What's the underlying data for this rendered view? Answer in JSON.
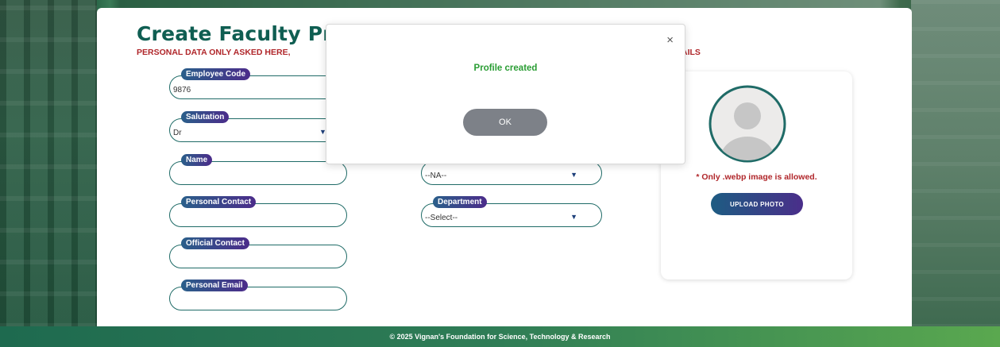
{
  "page": {
    "title": "Create Faculty Pro",
    "subtitle": "PERSONAL DATA ONLY ASKED HERE,",
    "subtitle_tail": "AILS"
  },
  "fields": {
    "employee_code": {
      "label": "Employee Code",
      "value": "9876"
    },
    "salutation": {
      "label": "Salutation",
      "value": "Dr"
    },
    "name": {
      "label": "Name",
      "value": ""
    },
    "personal_contact": {
      "label": "Personal Contact",
      "value": ""
    },
    "official_contact": {
      "label": "Official Contact",
      "value": ""
    },
    "personal_email": {
      "label": "Personal Email",
      "value": ""
    },
    "hidden_select": {
      "value": "--NA--"
    },
    "department": {
      "label": "Department",
      "value": "--Select--"
    }
  },
  "photo": {
    "note": "* Only .webp image is allowed.",
    "upload_label": "UPLOAD PHOTO"
  },
  "modal": {
    "message": "Profile created",
    "ok_label": "OK",
    "close_glyph": "×"
  },
  "footer": {
    "text": "© 2025 Vignan's Foundation for Science, Technology & Research"
  },
  "colors": {
    "title": "#0f5e52",
    "warning": "#b0262a",
    "success": "#2a9d34",
    "field_border": "#1f6b67"
  },
  "icons": {
    "caret": "▼",
    "avatar": "user-avatar-placeholder"
  }
}
